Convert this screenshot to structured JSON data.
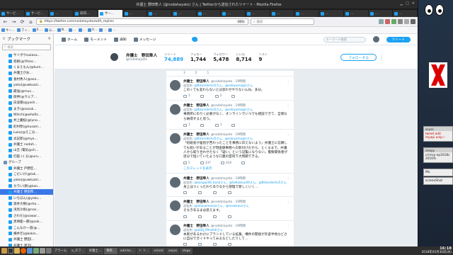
{
  "window": {
    "title": "弁護士 野田隼人 (@nodahayato) さん | Twitterから送信されたツイート - Mozilla Firefox"
  },
  "tabs": [
    {
      "label": "サービ…"
    },
    {
      "label": "サービ…"
    },
    {
      "label": "…"
    },
    {
      "label": "取得…"
    },
    {
      "label": "サー…"
    },
    {
      "label": "…"
    },
    {
      "label": "…"
    },
    {
      "label": "…"
    },
    {
      "label": "…"
    },
    {
      "label": "…"
    },
    {
      "label": "…"
    },
    {
      "label": "…"
    },
    {
      "label": "…"
    },
    {
      "label": "…"
    },
    {
      "label": "…"
    },
    {
      "label": "…"
    },
    {
      "label": "…"
    }
  ],
  "navbar": {
    "url": "https://twitter.com/nodahayato/with_replies",
    "zoom": "90%",
    "search_placeholder": "検索"
  },
  "bookmarks_bar": [
    {
      "label": "サー…"
    },
    {
      "label": "ブッ…"
    },
    {
      "label": "S …"
    },
    {
      "label": "公…"
    },
    {
      "label": "N…"
    },
    {
      "label": "…"
    },
    {
      "label": "…"
    },
    {
      "label": "X…"
    },
    {
      "label": "…"
    },
    {
      "label": "…"
    }
  ],
  "sidebar": {
    "title": "ブックマーク",
    "search_placeholder": "検索",
    "items": [
      {
        "label": "サイボウsukasa...",
        "folder": false,
        "selected": false
      },
      {
        "label": "鳥飼(@YAmo…",
        "folder": false,
        "selected": false
      },
      {
        "label": "くまえもん(@kum…",
        "folder": false,
        "selected": false
      },
      {
        "label": "弁護士がお…",
        "folder": false,
        "selected": false
      },
      {
        "label": "長村秀人(@asa…",
        "folder": false,
        "selected": false
      },
      {
        "label": "yoko(@uwkuzzi…",
        "folder": false,
        "selected": false
      },
      {
        "label": "最強(@mus…",
        "folder": false,
        "selected": false
      },
      {
        "label": "街神(@ウェア…",
        "folder": false,
        "selected": false
      },
      {
        "label": "白波陽(@yash…",
        "folder": false,
        "selected": false
      },
      {
        "label": "まき(@zuzuk…",
        "folder": false,
        "selected": false
      },
      {
        "label": "Which(@who0z…",
        "folder": false,
        "selected": false
      },
      {
        "label": "井上麗枝(@lyno…",
        "folder": false,
        "selected": false
      },
      {
        "label": "町村惇(@husam…",
        "folder": false,
        "selected": false
      },
      {
        "label": "Luka(@えこ分…",
        "folder": false,
        "selected": false
      },
      {
        "label": "太記郎(@myo…",
        "folder": false,
        "selected": false
      },
      {
        "label": "弁護士 nodah…",
        "folder": false,
        "selected": false
      },
      {
        "label": "山吉 (電気@ch…",
        "folder": false,
        "selected": false
      },
      {
        "label": "打越 (くる(@uru…",
        "folder": false,
        "selected": false
      },
      {
        "label": "グループ",
        "folder": true,
        "selected": false
      },
      {
        "label": "弁護士 戸野区…",
        "folder": false,
        "selected": false
      },
      {
        "label": "こだいけ(@tak…",
        "folder": false,
        "selected": false
      },
      {
        "label": "yoko(@uwkuzzi…",
        "folder": false,
        "selected": false
      },
      {
        "label": "カラい(楽(@kan…",
        "folder": false,
        "selected": false
      },
      {
        "label": "弁護士 野田隼…",
        "folder": false,
        "selected": true
      },
      {
        "label": "いちばん(@yoku…",
        "folder": false,
        "selected": false
      },
      {
        "label": "渡井大樹(@sho…",
        "folder": false,
        "selected": false
      },
      {
        "label": "浅見沙帆(@nas…",
        "folder": false,
        "selected": false
      },
      {
        "label": "さわだ(@sawar…",
        "folder": false,
        "selected": false
      },
      {
        "label": "黒埼鹿一朗(@sak…",
        "folder": false,
        "selected": false
      },
      {
        "label": "こんなか一道(@…",
        "folder": false,
        "selected": false
      },
      {
        "label": "横井元(@kokin…",
        "folder": false,
        "selected": false
      },
      {
        "label": "弁護士 野田(…",
        "folder": false,
        "selected": false
      },
      {
        "label": "弁護士 黒沼(…",
        "folder": false,
        "selected": false
      },
      {
        "label": "山本一輝(@yam…",
        "folder": false,
        "selected": false
      },
      {
        "label": "石田彩香 (… ",
        "folder": false,
        "selected": false
      }
    ]
  },
  "twitter_nav": {
    "home": "ホーム",
    "moments": "モーメント",
    "notifications": "通知",
    "messages": "メッセージ",
    "search_placeholder": "キーワード検索",
    "tweet_button": "ツイート"
  },
  "profile": {
    "name": "弁護士　野田隼人",
    "handle": "@nodahayato",
    "stats": [
      {
        "label": "ツイート",
        "value": "74,889"
      },
      {
        "label": "フォロー",
        "value": "1,744"
      },
      {
        "label": "フォロワー",
        "value": "5,478"
      },
      {
        "label": "いいね",
        "value": "8,714"
      },
      {
        "label": "リスト",
        "value": "9"
      }
    ],
    "follow_button": "フォローする"
  },
  "top_fragment": {
    "replies": "3",
    "retweets": "2",
    "likes": "1"
  },
  "tweets": [
    {
      "name": "弁護士　野田隼人",
      "meta": "@nodahayato · 19時間",
      "reply_to_prefix": "返信先:",
      "reply_to": "@Bikandesho5さん、@sekiyamaginさん",
      "text": "このくても変わらないとは思わせやりないんね、多分。",
      "replies": "1",
      "retweets": "",
      "likes": "2"
    },
    {
      "name": "弁護士　野田隼人",
      "meta": "@nodahayato · 19時間",
      "reply_to_prefix": "返信先:",
      "reply_to": "@Bikandesho5さん、@sekiyamaginさん",
      "text": "事務所にのりく必要がなく、オンラインでいつでも相談できて、全情なら納得すると思う。",
      "replies": "1",
      "retweets": "",
      "likes": "1"
    },
    {
      "name": "弁護士　野田隼人",
      "meta": "@nodahayato · 19時間",
      "reply_to_prefix": "返信先:",
      "reply_to": "@Bikandesho5さん、@sekiyamaginさん",
      "text": "「初総会が差別が苦わったことを事務に伝えないよう」弁護士に信頼しても続いがあることが現金額事務への影付けだから、とくるまで。弁護人から取り合わせたなく「疑い」という記覧になりない。警察関係者が思分で怪いていたような口裏の首同下大問題できる。",
      "replies": "5",
      "retweets": "337",
      "likes": "416",
      "show_thread": "このスレッドを表示"
    },
    {
      "name": "弁護士　野田隼人",
      "meta": "@nodahayato · 19時間",
      "reply_to_prefix": "返信先:",
      "reply_to": "@kongoji06_bookさん、@SeKaboudi9さん、@Bikandesho5さん",
      "text": "身上はつくったわりありなから管理で新しくいく…",
      "replies": "",
      "retweets": "",
      "likes": ""
    },
    {
      "name": "弁護士　野田隼人",
      "meta": "@nodahayato · 19時間",
      "reply_to_prefix": "返信先:",
      "reply_to": "@limasemanzaさん、@sssweaveさん",
      "text": "そなきあるまは思えます。",
      "replies": "",
      "retweets": "",
      "likes": ""
    },
    {
      "name": "弁護士　野田隼人",
      "meta": "@nodahayato · 19時間",
      "reply_to_prefix": "返信先:",
      "reply_to": "@ubRj_09saik6さん",
      "text": "本家があるわけにブランドしている拡業。構件の間接が外遊半地などさに自分でガイドやってみるなどしたりして…",
      "replies": "",
      "retweets": "",
      "likes": ""
    }
  ],
  "right_widgets": {
    "mini1_title": "xeyes",
    "mini1_text": "tweet add myapi unip r",
    "mini2_title": "sleepy",
    "mini2_text": "crimsy-ep2018c 2016%",
    "mini3_title": "",
    "mini3_text": "Mo",
    "mini4_text": "screenShot"
  },
  "taskbar": {
    "items": [
      "アラーム",
      "a_タフ…",
      "弁護士…",
      "事務…",
      "add-bo…",
      "ト ト…",
      "xclock",
      "xeyes",
      "xlogo"
    ],
    "time": "16:18",
    "date": "2018年05月30日(水)"
  }
}
